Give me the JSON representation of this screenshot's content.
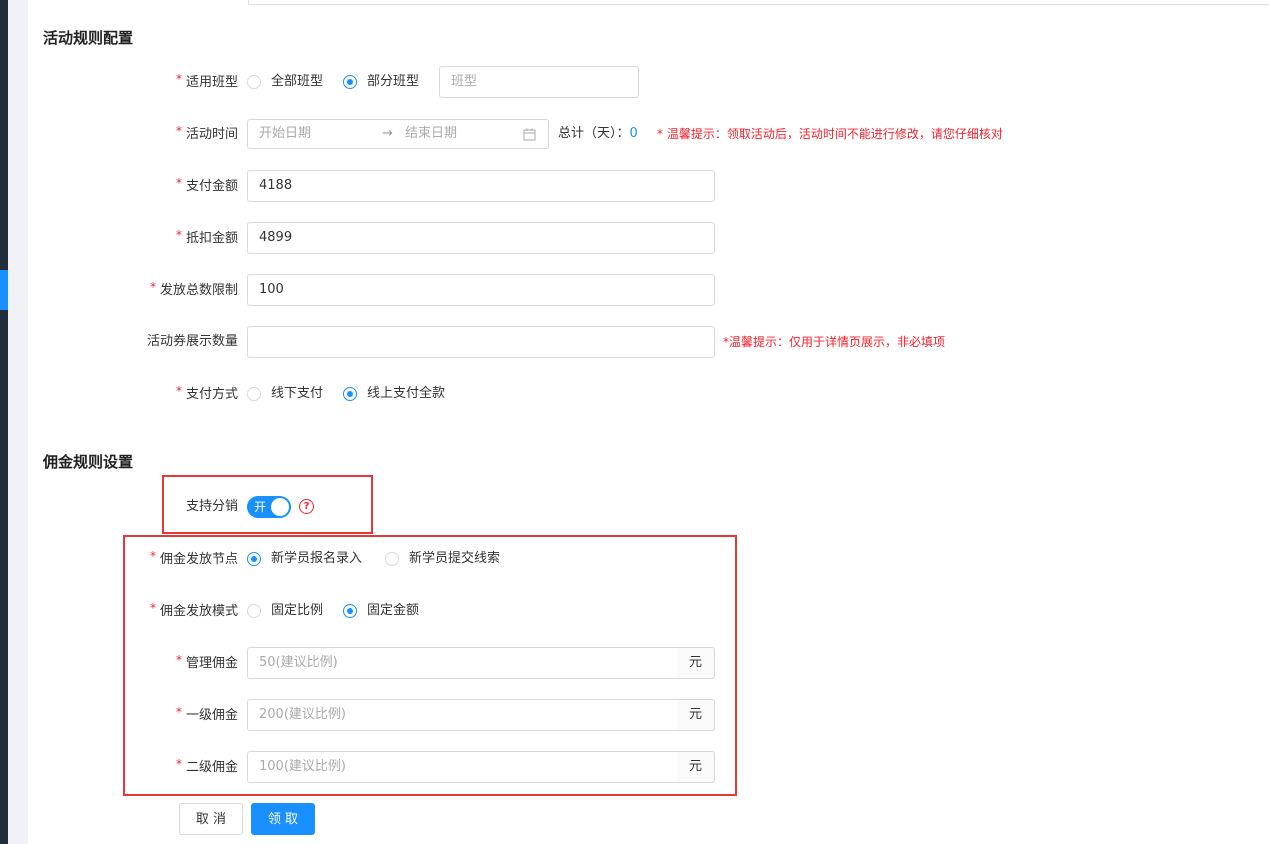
{
  "sections": {
    "activity_rules": "活动规则配置",
    "commission_rules": "佣金规则设置"
  },
  "activity": {
    "class_type": {
      "label": "适用班型",
      "options": [
        "全部班型",
        "部分班型"
      ],
      "selected": "部分班型",
      "input_placeholder": "班型"
    },
    "time": {
      "label": "活动时间",
      "start_placeholder": "开始日期",
      "end_placeholder": "结束日期",
      "total_label": "总计（天）：",
      "total_value": "0",
      "hint": "* 温馨提示：领取活动后，活动时间不能进行修改，请您仔细核对"
    },
    "pay_amount": {
      "label": "支付金额",
      "value": "4188"
    },
    "deduct_amount": {
      "label": "抵扣金额",
      "value": "4899"
    },
    "issue_limit": {
      "label": "发放总数限制",
      "value": "100"
    },
    "display_count": {
      "label": "活动券展示数量",
      "value": "",
      "hint": "*温馨提示：仅用于详情页展示，非必填项"
    },
    "payment_method": {
      "label": "支付方式",
      "options": [
        "线下支付",
        "线上支付全款"
      ],
      "selected": "线上支付全款"
    }
  },
  "commission": {
    "distribution": {
      "label": "支持分销",
      "switch_text": "开",
      "enabled": true
    },
    "node": {
      "label": "佣金发放节点",
      "options": [
        "新学员报名录入",
        "新学员提交线索"
      ],
      "selected": "新学员报名录入"
    },
    "mode": {
      "label": "佣金发放模式",
      "options": [
        "固定比例",
        "固定金额"
      ],
      "selected": "固定金额"
    },
    "management": {
      "label": "管理佣金",
      "placeholder": "50(建议比例)",
      "suffix": "元"
    },
    "level1": {
      "label": "一级佣金",
      "placeholder": "200(建议比例)",
      "suffix": "元"
    },
    "level2": {
      "label": "二级佣金",
      "placeholder": "100(建议比例)",
      "suffix": "元"
    }
  },
  "buttons": {
    "cancel": "取 消",
    "claim": "领 取"
  },
  "colors": {
    "primary": "#1890ff",
    "required": "#f5222d",
    "highlight_box": "#e53935"
  }
}
